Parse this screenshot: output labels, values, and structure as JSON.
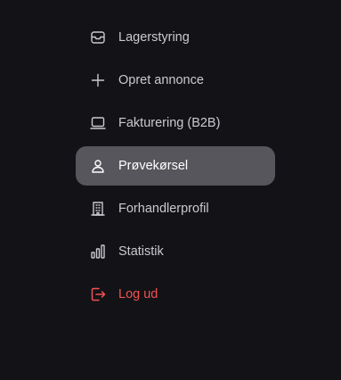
{
  "colors": {
    "background": "#131317",
    "text": "#c9c9cf",
    "active_background": "#56565c",
    "active_text": "#ffffff",
    "danger": "#f05252"
  },
  "nav": {
    "items": [
      {
        "label": "Lagerstyring",
        "icon": "inbox-icon"
      },
      {
        "label": "Opret annonce",
        "icon": "plus-icon"
      },
      {
        "label": "Fakturering (B2B)",
        "icon": "laptop-icon"
      },
      {
        "label": "Prøvekørsel",
        "icon": "user-icon",
        "active": true
      },
      {
        "label": "Forhandlerprofil",
        "icon": "building-icon"
      },
      {
        "label": "Statistik",
        "icon": "bar-chart-icon"
      },
      {
        "label": "Log ud",
        "icon": "logout-icon"
      }
    ]
  }
}
